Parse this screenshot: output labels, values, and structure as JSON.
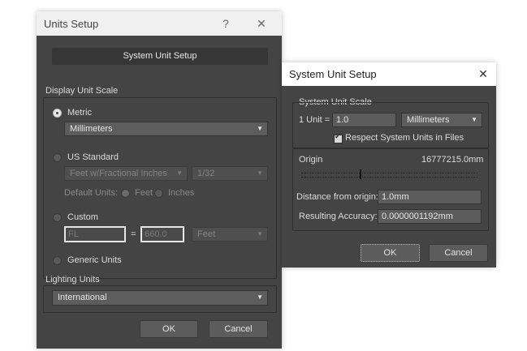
{
  "units_setup": {
    "title": "Units Setup",
    "help_glyph": "?",
    "close_glyph": "✕",
    "system_unit_setup_button": "System Unit Setup",
    "display_unit_scale": {
      "label": "Display Unit Scale",
      "metric": {
        "label": "Metric",
        "selected": true,
        "value": "Millimeters"
      },
      "us_standard": {
        "label": "US Standard",
        "selected": false,
        "unit_value": "Feet w/Fractional Inches",
        "fraction_value": "1/32",
        "default_units_label": "Default Units:",
        "feet_label": "Feet",
        "inches_label": "Inches"
      },
      "custom": {
        "label": "Custom",
        "selected": false,
        "name_value": "FL",
        "equals": "=",
        "amount_value": "660.0",
        "unit_value": "Feet"
      },
      "generic": {
        "label": "Generic Units",
        "selected": false
      }
    },
    "lighting_units": {
      "label": "Lighting Units",
      "value": "International"
    },
    "ok_label": "OK",
    "cancel_label": "Cancel"
  },
  "system_unit_setup": {
    "title": "System Unit Setup",
    "close_glyph": "✕",
    "scale_label": "System Unit Scale",
    "one_unit_label": "1 Unit =",
    "scale_value": "1.0",
    "unit_value": "Millimeters",
    "respect_label": "Respect System Units in Files",
    "respect_checked": true,
    "origin_label": "Origin",
    "origin_value": "16777215.0mm",
    "distance_label": "Distance from origin:",
    "distance_value": "1.0mm",
    "accuracy_label": "Resulting Accuracy:",
    "accuracy_value": "0.0000001192mm",
    "ok_label": "OK",
    "cancel_label": "Cancel"
  },
  "colors": {
    "dialog_bg": "#444444",
    "title_bar": "#f0f0f0",
    "field_bg": "#5c5c5c"
  }
}
